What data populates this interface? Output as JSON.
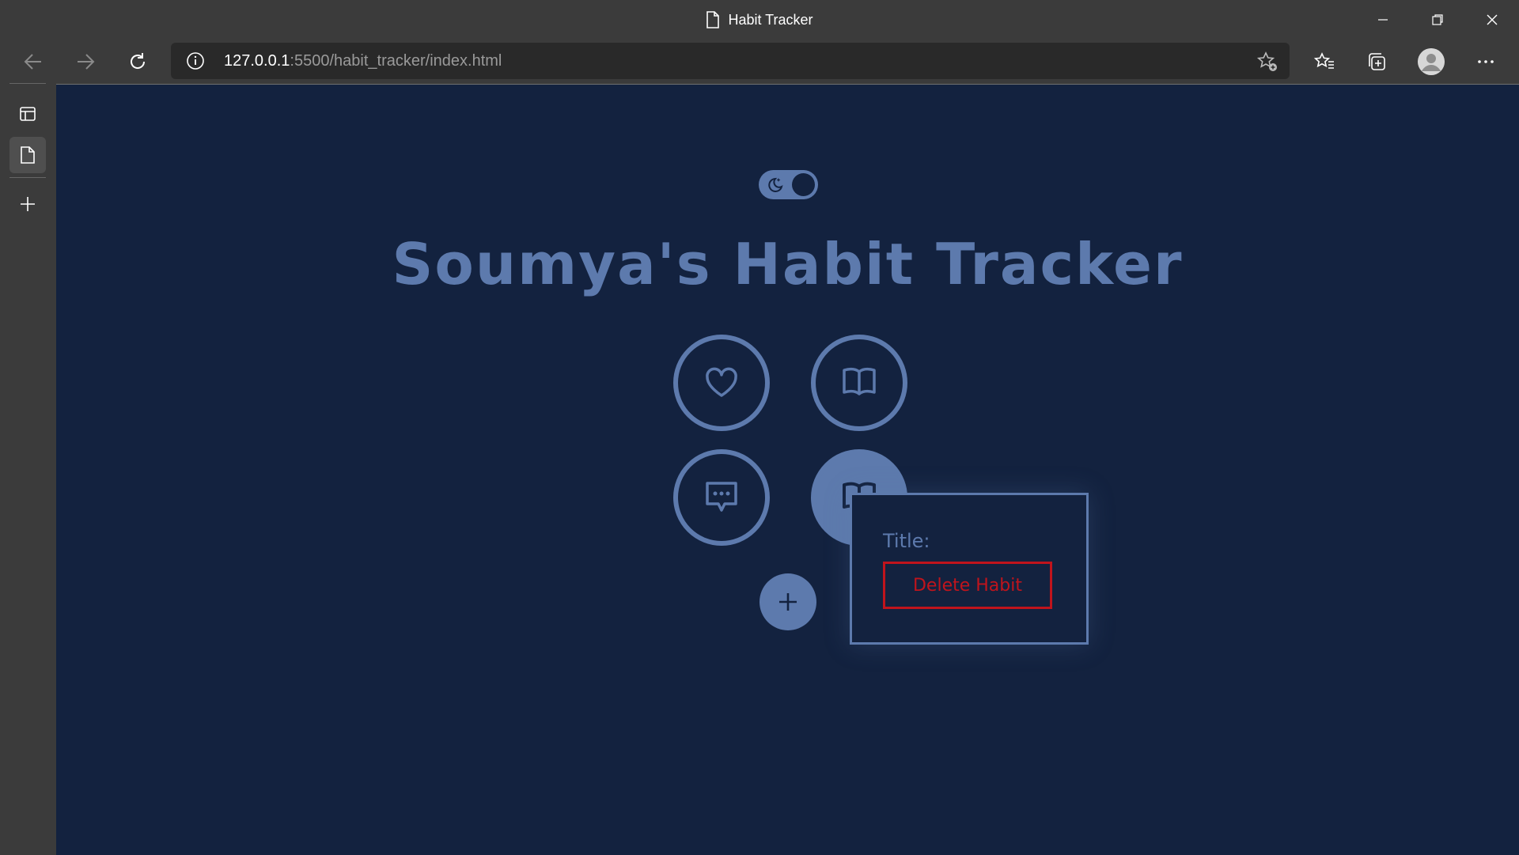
{
  "window": {
    "title": "Habit Tracker"
  },
  "browser": {
    "url_host": "127.0.0.1",
    "url_rest": ":5500/habit_tracker/index.html"
  },
  "page": {
    "heading": "Soumya's Habit Tracker",
    "theme_toggle": {
      "mode": "dark",
      "icon": "moon-star-icon"
    },
    "habits": [
      {
        "icon": "heart-icon",
        "selected": false
      },
      {
        "icon": "book-open-icon",
        "selected": false
      },
      {
        "icon": "message-dots-icon",
        "selected": false
      },
      {
        "icon": "book-icon",
        "selected": true
      }
    ],
    "add_button_icon": "plus-icon",
    "popup": {
      "title_label": "Title:",
      "delete_label": "Delete Habit"
    }
  },
  "colors": {
    "background": "#13223f",
    "accent": "#5d7aad",
    "danger": "#c0141c"
  }
}
